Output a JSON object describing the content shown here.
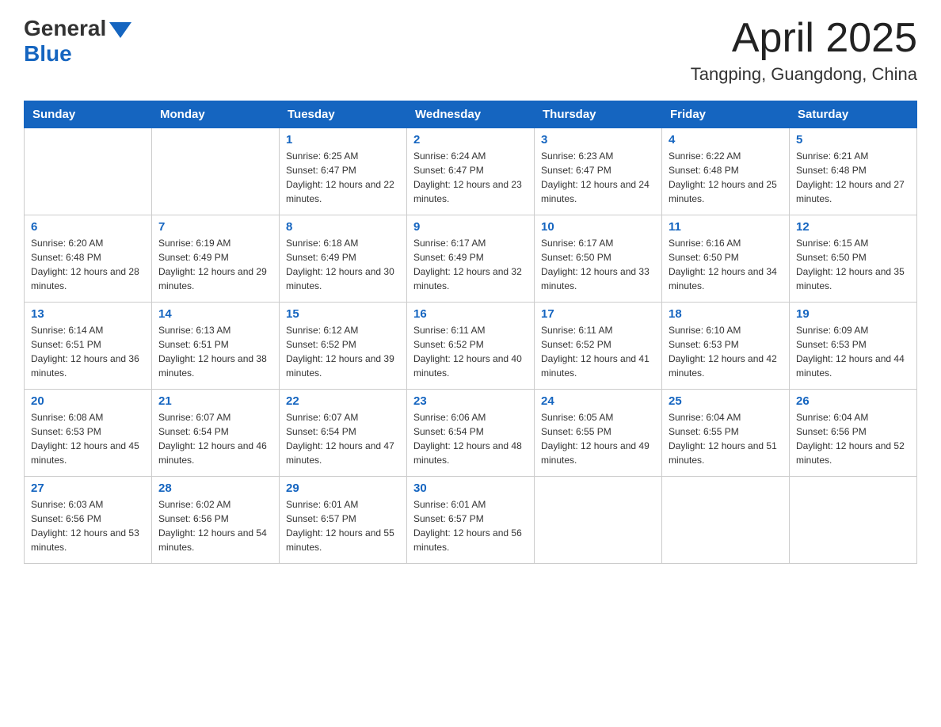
{
  "header": {
    "logo_general": "General",
    "logo_blue": "Blue",
    "title": "April 2025",
    "location": "Tangping, Guangdong, China"
  },
  "weekdays": [
    "Sunday",
    "Monday",
    "Tuesday",
    "Wednesday",
    "Thursday",
    "Friday",
    "Saturday"
  ],
  "weeks": [
    [
      {
        "day": "",
        "sunrise": "",
        "sunset": "",
        "daylight": ""
      },
      {
        "day": "",
        "sunrise": "",
        "sunset": "",
        "daylight": ""
      },
      {
        "day": "1",
        "sunrise": "Sunrise: 6:25 AM",
        "sunset": "Sunset: 6:47 PM",
        "daylight": "Daylight: 12 hours and 22 minutes."
      },
      {
        "day": "2",
        "sunrise": "Sunrise: 6:24 AM",
        "sunset": "Sunset: 6:47 PM",
        "daylight": "Daylight: 12 hours and 23 minutes."
      },
      {
        "day": "3",
        "sunrise": "Sunrise: 6:23 AM",
        "sunset": "Sunset: 6:47 PM",
        "daylight": "Daylight: 12 hours and 24 minutes."
      },
      {
        "day": "4",
        "sunrise": "Sunrise: 6:22 AM",
        "sunset": "Sunset: 6:48 PM",
        "daylight": "Daylight: 12 hours and 25 minutes."
      },
      {
        "day": "5",
        "sunrise": "Sunrise: 6:21 AM",
        "sunset": "Sunset: 6:48 PM",
        "daylight": "Daylight: 12 hours and 27 minutes."
      }
    ],
    [
      {
        "day": "6",
        "sunrise": "Sunrise: 6:20 AM",
        "sunset": "Sunset: 6:48 PM",
        "daylight": "Daylight: 12 hours and 28 minutes."
      },
      {
        "day": "7",
        "sunrise": "Sunrise: 6:19 AM",
        "sunset": "Sunset: 6:49 PM",
        "daylight": "Daylight: 12 hours and 29 minutes."
      },
      {
        "day": "8",
        "sunrise": "Sunrise: 6:18 AM",
        "sunset": "Sunset: 6:49 PM",
        "daylight": "Daylight: 12 hours and 30 minutes."
      },
      {
        "day": "9",
        "sunrise": "Sunrise: 6:17 AM",
        "sunset": "Sunset: 6:49 PM",
        "daylight": "Daylight: 12 hours and 32 minutes."
      },
      {
        "day": "10",
        "sunrise": "Sunrise: 6:17 AM",
        "sunset": "Sunset: 6:50 PM",
        "daylight": "Daylight: 12 hours and 33 minutes."
      },
      {
        "day": "11",
        "sunrise": "Sunrise: 6:16 AM",
        "sunset": "Sunset: 6:50 PM",
        "daylight": "Daylight: 12 hours and 34 minutes."
      },
      {
        "day": "12",
        "sunrise": "Sunrise: 6:15 AM",
        "sunset": "Sunset: 6:50 PM",
        "daylight": "Daylight: 12 hours and 35 minutes."
      }
    ],
    [
      {
        "day": "13",
        "sunrise": "Sunrise: 6:14 AM",
        "sunset": "Sunset: 6:51 PM",
        "daylight": "Daylight: 12 hours and 36 minutes."
      },
      {
        "day": "14",
        "sunrise": "Sunrise: 6:13 AM",
        "sunset": "Sunset: 6:51 PM",
        "daylight": "Daylight: 12 hours and 38 minutes."
      },
      {
        "day": "15",
        "sunrise": "Sunrise: 6:12 AM",
        "sunset": "Sunset: 6:52 PM",
        "daylight": "Daylight: 12 hours and 39 minutes."
      },
      {
        "day": "16",
        "sunrise": "Sunrise: 6:11 AM",
        "sunset": "Sunset: 6:52 PM",
        "daylight": "Daylight: 12 hours and 40 minutes."
      },
      {
        "day": "17",
        "sunrise": "Sunrise: 6:11 AM",
        "sunset": "Sunset: 6:52 PM",
        "daylight": "Daylight: 12 hours and 41 minutes."
      },
      {
        "day": "18",
        "sunrise": "Sunrise: 6:10 AM",
        "sunset": "Sunset: 6:53 PM",
        "daylight": "Daylight: 12 hours and 42 minutes."
      },
      {
        "day": "19",
        "sunrise": "Sunrise: 6:09 AM",
        "sunset": "Sunset: 6:53 PM",
        "daylight": "Daylight: 12 hours and 44 minutes."
      }
    ],
    [
      {
        "day": "20",
        "sunrise": "Sunrise: 6:08 AM",
        "sunset": "Sunset: 6:53 PM",
        "daylight": "Daylight: 12 hours and 45 minutes."
      },
      {
        "day": "21",
        "sunrise": "Sunrise: 6:07 AM",
        "sunset": "Sunset: 6:54 PM",
        "daylight": "Daylight: 12 hours and 46 minutes."
      },
      {
        "day": "22",
        "sunrise": "Sunrise: 6:07 AM",
        "sunset": "Sunset: 6:54 PM",
        "daylight": "Daylight: 12 hours and 47 minutes."
      },
      {
        "day": "23",
        "sunrise": "Sunrise: 6:06 AM",
        "sunset": "Sunset: 6:54 PM",
        "daylight": "Daylight: 12 hours and 48 minutes."
      },
      {
        "day": "24",
        "sunrise": "Sunrise: 6:05 AM",
        "sunset": "Sunset: 6:55 PM",
        "daylight": "Daylight: 12 hours and 49 minutes."
      },
      {
        "day": "25",
        "sunrise": "Sunrise: 6:04 AM",
        "sunset": "Sunset: 6:55 PM",
        "daylight": "Daylight: 12 hours and 51 minutes."
      },
      {
        "day": "26",
        "sunrise": "Sunrise: 6:04 AM",
        "sunset": "Sunset: 6:56 PM",
        "daylight": "Daylight: 12 hours and 52 minutes."
      }
    ],
    [
      {
        "day": "27",
        "sunrise": "Sunrise: 6:03 AM",
        "sunset": "Sunset: 6:56 PM",
        "daylight": "Daylight: 12 hours and 53 minutes."
      },
      {
        "day": "28",
        "sunrise": "Sunrise: 6:02 AM",
        "sunset": "Sunset: 6:56 PM",
        "daylight": "Daylight: 12 hours and 54 minutes."
      },
      {
        "day": "29",
        "sunrise": "Sunrise: 6:01 AM",
        "sunset": "Sunset: 6:57 PM",
        "daylight": "Daylight: 12 hours and 55 minutes."
      },
      {
        "day": "30",
        "sunrise": "Sunrise: 6:01 AM",
        "sunset": "Sunset: 6:57 PM",
        "daylight": "Daylight: 12 hours and 56 minutes."
      },
      {
        "day": "",
        "sunrise": "",
        "sunset": "",
        "daylight": ""
      },
      {
        "day": "",
        "sunrise": "",
        "sunset": "",
        "daylight": ""
      },
      {
        "day": "",
        "sunrise": "",
        "sunset": "",
        "daylight": ""
      }
    ]
  ]
}
